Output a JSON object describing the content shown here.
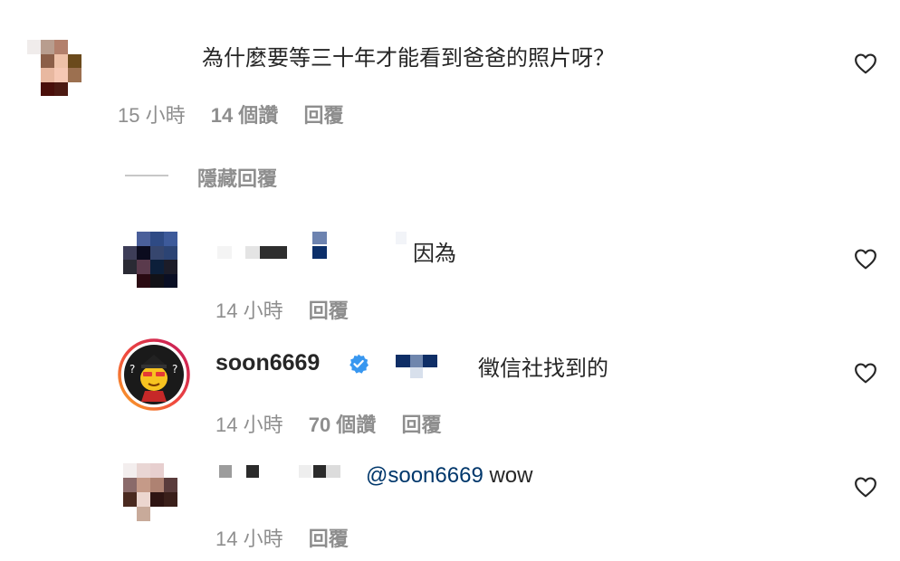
{
  "comments": [
    {
      "text": "為什麼要等三十年才能看到爸爸的照片呀？",
      "time": "15 小時",
      "likes": "14 個讚",
      "reply_label": "回覆"
    }
  ],
  "hide_replies_label": "隱藏回覆",
  "replies": [
    {
      "text": "因為",
      "time": "14 小時",
      "reply_label": "回覆"
    },
    {
      "username": "soon6669",
      "verified": true,
      "text": "徵信社找到的",
      "time": "14 小時",
      "likes": "70 個讚",
      "reply_label": "回覆"
    },
    {
      "mention": "@soon6669",
      "text": "wow",
      "time": "14 小時",
      "reply_label": "回覆"
    }
  ],
  "icons": {
    "heart": "heart-outline-icon",
    "verified": "verified-badge-icon"
  },
  "colors": {
    "text": "#262626",
    "meta": "#8e8e8e",
    "mention": "#00376b",
    "verified": "#3897f0"
  }
}
